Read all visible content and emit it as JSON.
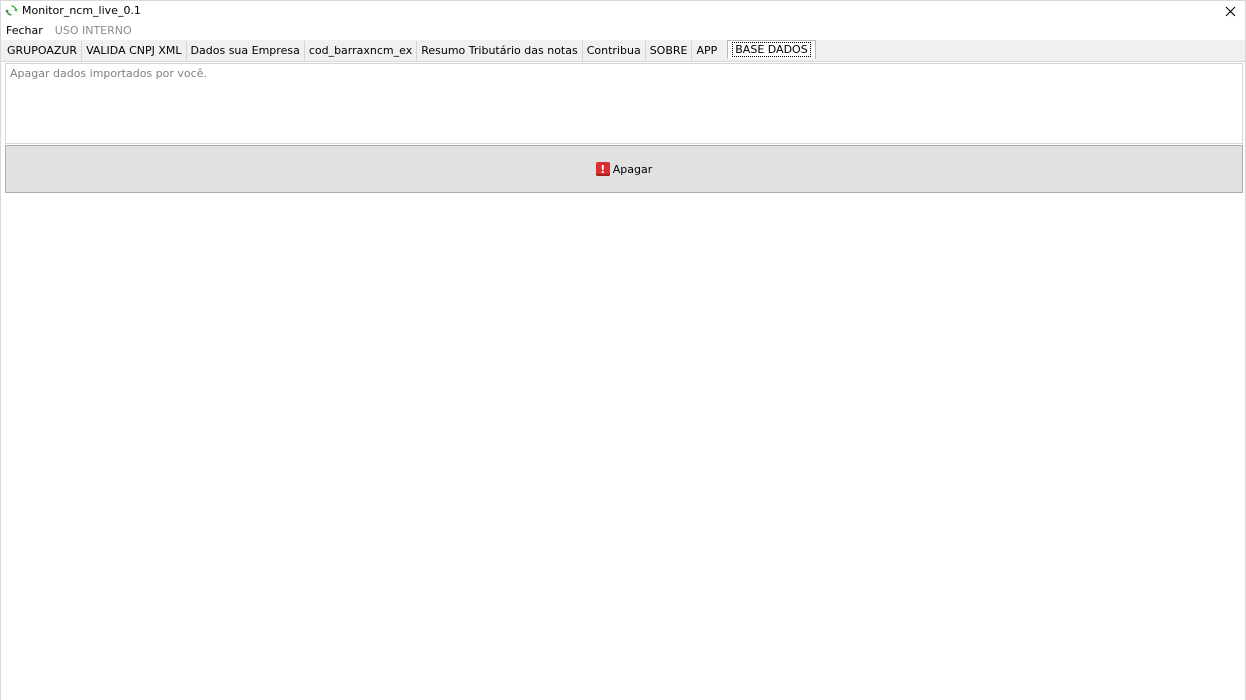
{
  "window": {
    "title": "Monitor_ncm_live_0.1",
    "close_icon": "close-icon",
    "app_icon": "refresh-arrows-icon",
    "app_icon_color": "#3cb043"
  },
  "menubar": {
    "items": [
      {
        "label": "Fechar",
        "enabled": true
      },
      {
        "label": "USO INTERNO",
        "enabled": false
      }
    ]
  },
  "tabs": [
    {
      "label": "GRUPOAZUR"
    },
    {
      "label": "VALIDA CNPJ XML"
    },
    {
      "label": "Dados sua Empresa"
    },
    {
      "label": "cod_barraxncm_ex"
    },
    {
      "label": "Resumo Tributário das notas"
    },
    {
      "label": "Contribua"
    },
    {
      "label": "SOBRE"
    },
    {
      "label": "APP"
    },
    {
      "label": "BASE DADOS",
      "active": true
    }
  ],
  "base_dados": {
    "description": "Apagar dados importados por você.",
    "button_label": "Apagar",
    "button_icon": "warning-icon",
    "button_icon_color": "#d9302f"
  }
}
